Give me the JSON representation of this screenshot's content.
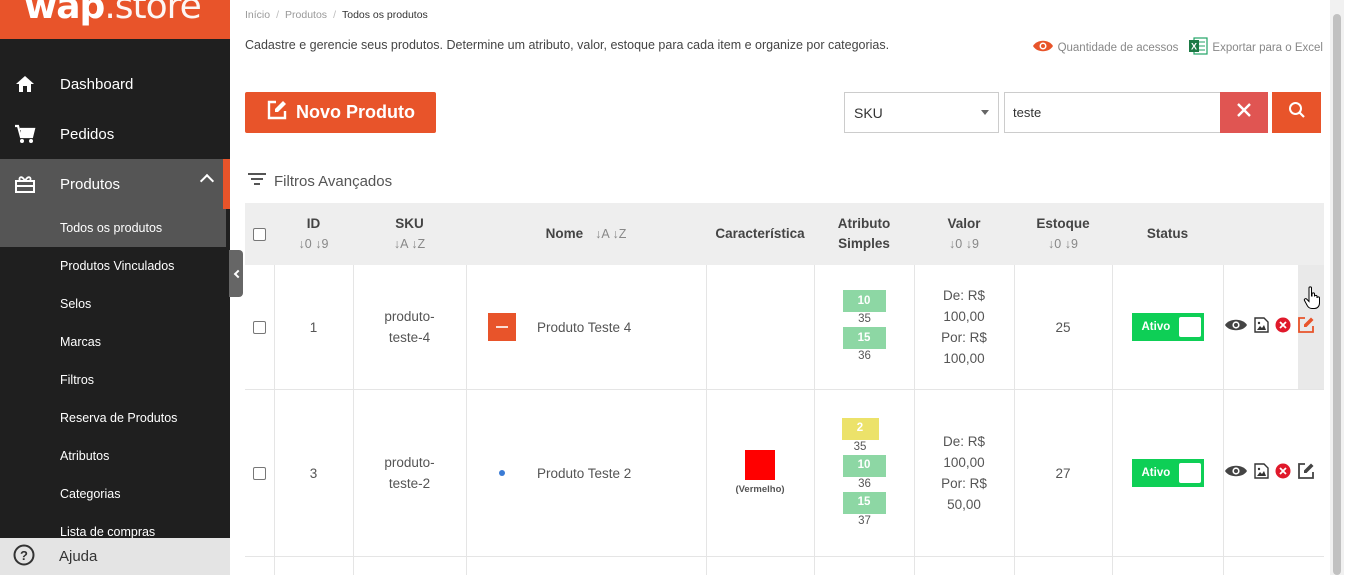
{
  "brand": {
    "name_bold": "wap",
    "name_light": ".store",
    "accent": "#e8542a"
  },
  "sidebar": {
    "main_items": [
      {
        "label": "Dashboard",
        "icon": "home-icon"
      },
      {
        "label": "Pedidos",
        "icon": "cart-icon"
      },
      {
        "label": "Produtos",
        "icon": "gift-icon"
      }
    ],
    "sub_items": [
      {
        "label": "Todos os produtos"
      },
      {
        "label": "Produtos Vinculados"
      },
      {
        "label": "Selos"
      },
      {
        "label": "Marcas"
      },
      {
        "label": "Filtros"
      },
      {
        "label": "Reserva de Produtos"
      },
      {
        "label": "Atributos"
      },
      {
        "label": "Categorias"
      },
      {
        "label": "Lista de compras"
      }
    ],
    "help_label": "Ajuda"
  },
  "breadcrumb": [
    "Início",
    "Produtos",
    "Todos os produtos"
  ],
  "description": "Cadastre e gerencie seus produtos. Determine um atributo, valor, estoque para cada item e organize por categorias.",
  "links": {
    "views": "Quantidade de acessos",
    "export": "Exportar para o Excel"
  },
  "toolbar": {
    "new_label": "Novo Produto",
    "search_field": "SKU",
    "search_value": "teste",
    "filters_label": "Filtros Avançados"
  },
  "table": {
    "headers": {
      "id": "ID",
      "id_sort": "↓0 ↓9",
      "sku": "SKU",
      "sku_sort": "↓A ↓Z",
      "name": "Nome",
      "name_sort": "↓A ↓Z",
      "feature": "Característica",
      "attr1": "Atributo",
      "attr2": "Simples",
      "value": "Valor",
      "value_sort": "↓0 ↓9",
      "stock": "Estoque",
      "stock_sort": "↓0 ↓9",
      "status": "Status"
    },
    "rows": [
      {
        "id": "1",
        "sku1": "produto-",
        "sku2": "teste-4",
        "name": "Produto Teste 4",
        "attrs": [
          {
            "tag": "10",
            "qty": "35",
            "color": "#8dd7a4"
          },
          {
            "tag": "15",
            "qty": "36",
            "color": "#8dd7a4"
          }
        ],
        "value": [
          "De: R$",
          "100,00",
          "Por: R$",
          "100,00"
        ],
        "stock": "25",
        "status": "Ativo"
      },
      {
        "id": "3",
        "sku1": "produto-",
        "sku2": "teste-2",
        "name": "Produto Teste 2",
        "feature_color": "#ff0000",
        "feature_label": "(Vermelho)",
        "attrs": [
          {
            "tag": "2",
            "qty": "35",
            "color": "#ece26a"
          },
          {
            "tag": "10",
            "qty": "36",
            "color": "#8dd7a4"
          },
          {
            "tag": "15",
            "qty": "37",
            "color": "#8dd7a4"
          }
        ],
        "value": [
          "De: R$",
          "100,00",
          "Por: R$",
          "50,00"
        ],
        "stock": "27",
        "status": "Ativo"
      }
    ]
  }
}
